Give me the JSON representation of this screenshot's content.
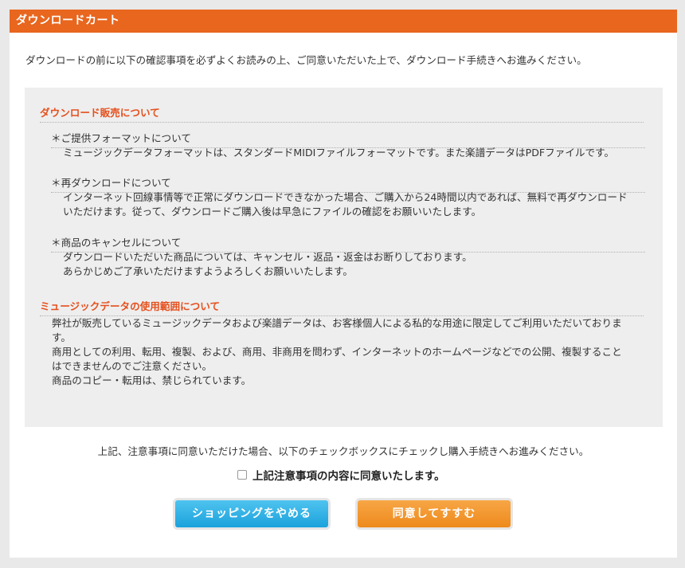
{
  "header": {
    "title": "ダウンロードカート"
  },
  "intro": "ダウンロードの前に以下の確認事項を必ずよくお読みの上、ご同意いただいた上で、ダウンロード手続きへお進みください。",
  "sales": {
    "title": "ダウンロード販売について",
    "items": [
      {
        "head": "＊ご提供フォーマットについて",
        "lines": [
          "ミュージックデータフォーマットは、スタンダードMIDIファイルフォーマットです。また楽譜データはPDFファイルです。"
        ]
      },
      {
        "head": "＊再ダウンロードについて",
        "lines": [
          "インターネット回線事情等で正常にダウンロードできなかった場合、ご購入から24時間以内であれば、無料で再ダウンロード",
          "いただけます。従って、ダウンロードご購入後は早急にファイルの確認をお願いいたします。"
        ]
      },
      {
        "head": "＊商品のキャンセルについて",
        "lines": [
          "ダウンロードいただいた商品については、キャンセル・返品・返金はお断りしております。",
          "あらかじめご了承いただけますようよろしくお願いいたします。"
        ]
      }
    ]
  },
  "usage": {
    "title": "ミュージックデータの使用範囲について",
    "lines": [
      "弊社が販売しているミュージックデータおよび楽譜データは、お客様個人による私的な用途に限定してご利用いただいておりま",
      "す。",
      "商用としての利用、転用、複製、および、商用、非商用を問わず、インターネットのホームページなどでの公開、複製すること",
      "はできませんのでご注意ください。",
      "商品のコピー・転用は、禁じられています。"
    ]
  },
  "instruction": "上記、注意事項に同意いただけた場合、以下のチェックボックスにチェックし購入手続きへお進みください。",
  "agree_label": "上記注意事項の内容に同意いたします。",
  "buttons": {
    "cancel": "ショッピングをやめる",
    "agree": "同意してすすむ"
  },
  "colors": {
    "header": "#e8661e",
    "section_title": "#e5501e",
    "cancel_button": "#1ba2dc",
    "agree_button": "#ee8a1c"
  }
}
